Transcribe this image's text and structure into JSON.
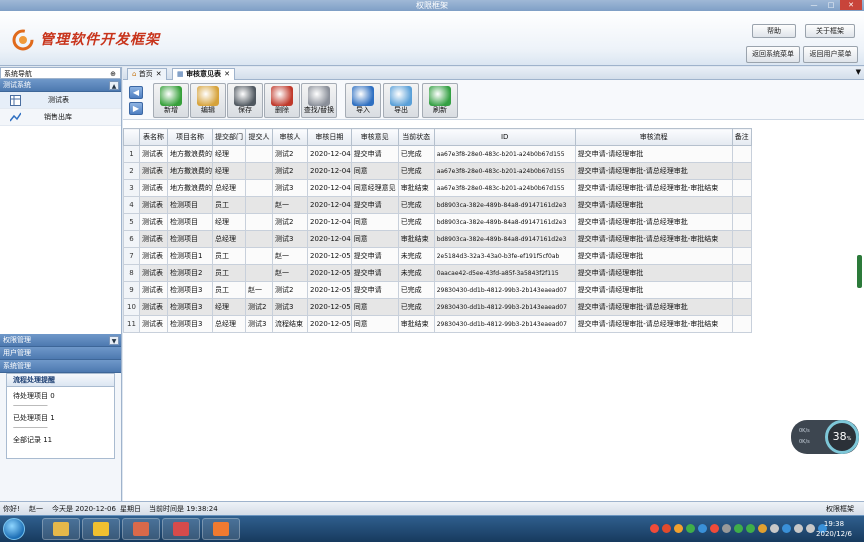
{
  "window": {
    "title": "权限框架",
    "controls": [
      "—",
      "□",
      "✕"
    ]
  },
  "header": {
    "logo_text": "管理软件开发框架",
    "btn_small_1": "帮助",
    "btn_small_2": "关于框架",
    "btn_back_system": "返回系统菜单",
    "btn_back_user": "返回用户菜单"
  },
  "leftnav": {
    "title": "系统导航",
    "pin": "⊕",
    "section_top": "测试系统",
    "items": [
      {
        "label": "测试表",
        "icon": "table-icon"
      },
      {
        "label": "销售出库",
        "icon": "chart-icon"
      }
    ],
    "sections_bottom": [
      "权限管理",
      "用户管理",
      "系统管理"
    ],
    "panel": {
      "title": "流程处理提醒",
      "pending": "待处理项目   0",
      "dash": "-----------------------------",
      "done": "已处理项目   1",
      "total": "全部记录    11"
    }
  },
  "tabs": [
    {
      "label": "首页",
      "close": "✕"
    },
    {
      "label": "审核意见表",
      "close": "✕"
    }
  ],
  "toolbar": {
    "buttons": [
      {
        "label": "新增",
        "color": "#36a03a"
      },
      {
        "label": "编辑",
        "color": "#d6a23a"
      },
      {
        "label": "保存",
        "color": "#505860"
      },
      {
        "label": "删除",
        "color": "#c0392b"
      },
      {
        "label": "查找/替换",
        "color": "#8a8f99"
      },
      {
        "label": "导入",
        "color": "#2e6fc1"
      },
      {
        "label": "导出",
        "color": "#5aa0d8"
      },
      {
        "label": "刷新",
        "color": "#34a043"
      }
    ]
  },
  "grid": {
    "columns": [
      "",
      "表名称",
      "项目名称",
      "提交部门",
      "提交人",
      "审核人",
      "审核日期",
      "审核意见",
      "当前状态",
      "ID",
      "审核流程",
      "备注"
    ],
    "rows": [
      [
        "1",
        "测试表",
        "地方撒浪费的",
        "经理",
        "",
        "测试2",
        "2020-12-04",
        "提交申请",
        "已完成",
        "aa67e3f8-28e0-483c-b201-a24b0b67d155",
        "提交申请-请经理审批",
        ""
      ],
      [
        "2",
        "测试表",
        "地方撒浪费的",
        "经理",
        "",
        "测试2",
        "2020-12-04",
        "同意",
        "已完成",
        "aa67e3f8-28e0-483c-b201-a24b0b67d155",
        "提交申请-请经理审批-请总经理审批",
        ""
      ],
      [
        "3",
        "测试表",
        "地方撒浪费的",
        "总经理",
        "",
        "测试3",
        "2020-12-04",
        "同意经理意见",
        "审批结束",
        "aa67e3f8-28e0-483c-b201-a24b0b67d155",
        "提交申请-请经理审批-请总经理审批-审批结束",
        ""
      ],
      [
        "4",
        "测试表",
        "检测项目",
        "员工",
        "",
        "赵一",
        "2020-12-04",
        "提交申请",
        "已完成",
        "bd8903ca-382e-489b-84a8-d9147161d2e3",
        "提交申请-请经理审批",
        ""
      ],
      [
        "5",
        "测试表",
        "检测项目",
        "经理",
        "",
        "测试2",
        "2020-12-04",
        "同意",
        "已完成",
        "bd8903ca-382e-489b-84a8-d9147161d2e3",
        "提交申请-请经理审批-请总经理审批",
        ""
      ],
      [
        "6",
        "测试表",
        "检测项目",
        "总经理",
        "",
        "测试3",
        "2020-12-04",
        "同意",
        "审批结束",
        "bd8903ca-382e-489b-84a8-d9147161d2e3",
        "提交申请-请经理审批-请总经理审批-审批结束",
        ""
      ],
      [
        "7",
        "测试表",
        "检测项目1",
        "员工",
        "",
        "赵一",
        "2020-12-05",
        "提交申请",
        "未完成",
        "2e5184d3-32a3-43a0-b3fe-ef191f5cf0ab",
        "提交申请-请经理审批",
        ""
      ],
      [
        "8",
        "测试表",
        "检测项目2",
        "员工",
        "",
        "赵一",
        "2020-12-05",
        "提交申请",
        "未完成",
        "0aacae42-d5ee-43fd-a85f-3a5843f2f115",
        "提交申请-请经理审批",
        ""
      ],
      [
        "9",
        "测试表",
        "检测项目3",
        "员工",
        "赵一",
        "测试2",
        "2020-12-05",
        "提交申请",
        "已完成",
        "29830430-dd1b-4812-99b3-2b143eaead07",
        "提交申请-请经理审批",
        ""
      ],
      [
        "10",
        "测试表",
        "检测项目3",
        "经理",
        "测试2",
        "测试3",
        "2020-12-05",
        "同意",
        "已完成",
        "29830430-dd1b-4812-99b3-2b143eaead07",
        "提交申请-请经理审批-请总经理审批",
        ""
      ],
      [
        "11",
        "测试表",
        "检测项目3",
        "总经理",
        "测试3",
        "流程结束",
        "2020-12-05",
        "同意",
        "审批结束",
        "29830430-dd1b-4812-99b3-2b143eaead07",
        "提交申请-请经理审批-请总经理审批-审批结束",
        ""
      ]
    ]
  },
  "widget": {
    "value": "38",
    "unit": "%",
    "up": "0K/s",
    "down": "0K/s"
  },
  "status": {
    "greeting": "你好!",
    "user": "赵一",
    "today": "今天是 2020-12-06",
    "weekday": "星期日",
    "time": "当前时间是 19:38:24",
    "app": "权限框架"
  },
  "taskbar": {
    "time": "19:38",
    "date": "2020/12/6",
    "apps": [
      {
        "name": "explorer",
        "color": "#e6b84a"
      },
      {
        "name": "help",
        "color": "#f0c030"
      },
      {
        "name": "paint",
        "color": "#d9694a"
      },
      {
        "name": "app",
        "color": "#d64b4b"
      },
      {
        "name": "app2",
        "color": "#f07a30"
      }
    ],
    "tray_colors": [
      "#f04b3a",
      "#e24a2c",
      "#f2a12e",
      "#3fae49",
      "#3a90d8",
      "#f04b3a",
      "#999999",
      "#3fae49",
      "#3fae49",
      "#e0a030",
      "#c8c8c8",
      "#3a90d8",
      "#c8c8c8",
      "#c8c8c8",
      "#3a90d8"
    ]
  }
}
